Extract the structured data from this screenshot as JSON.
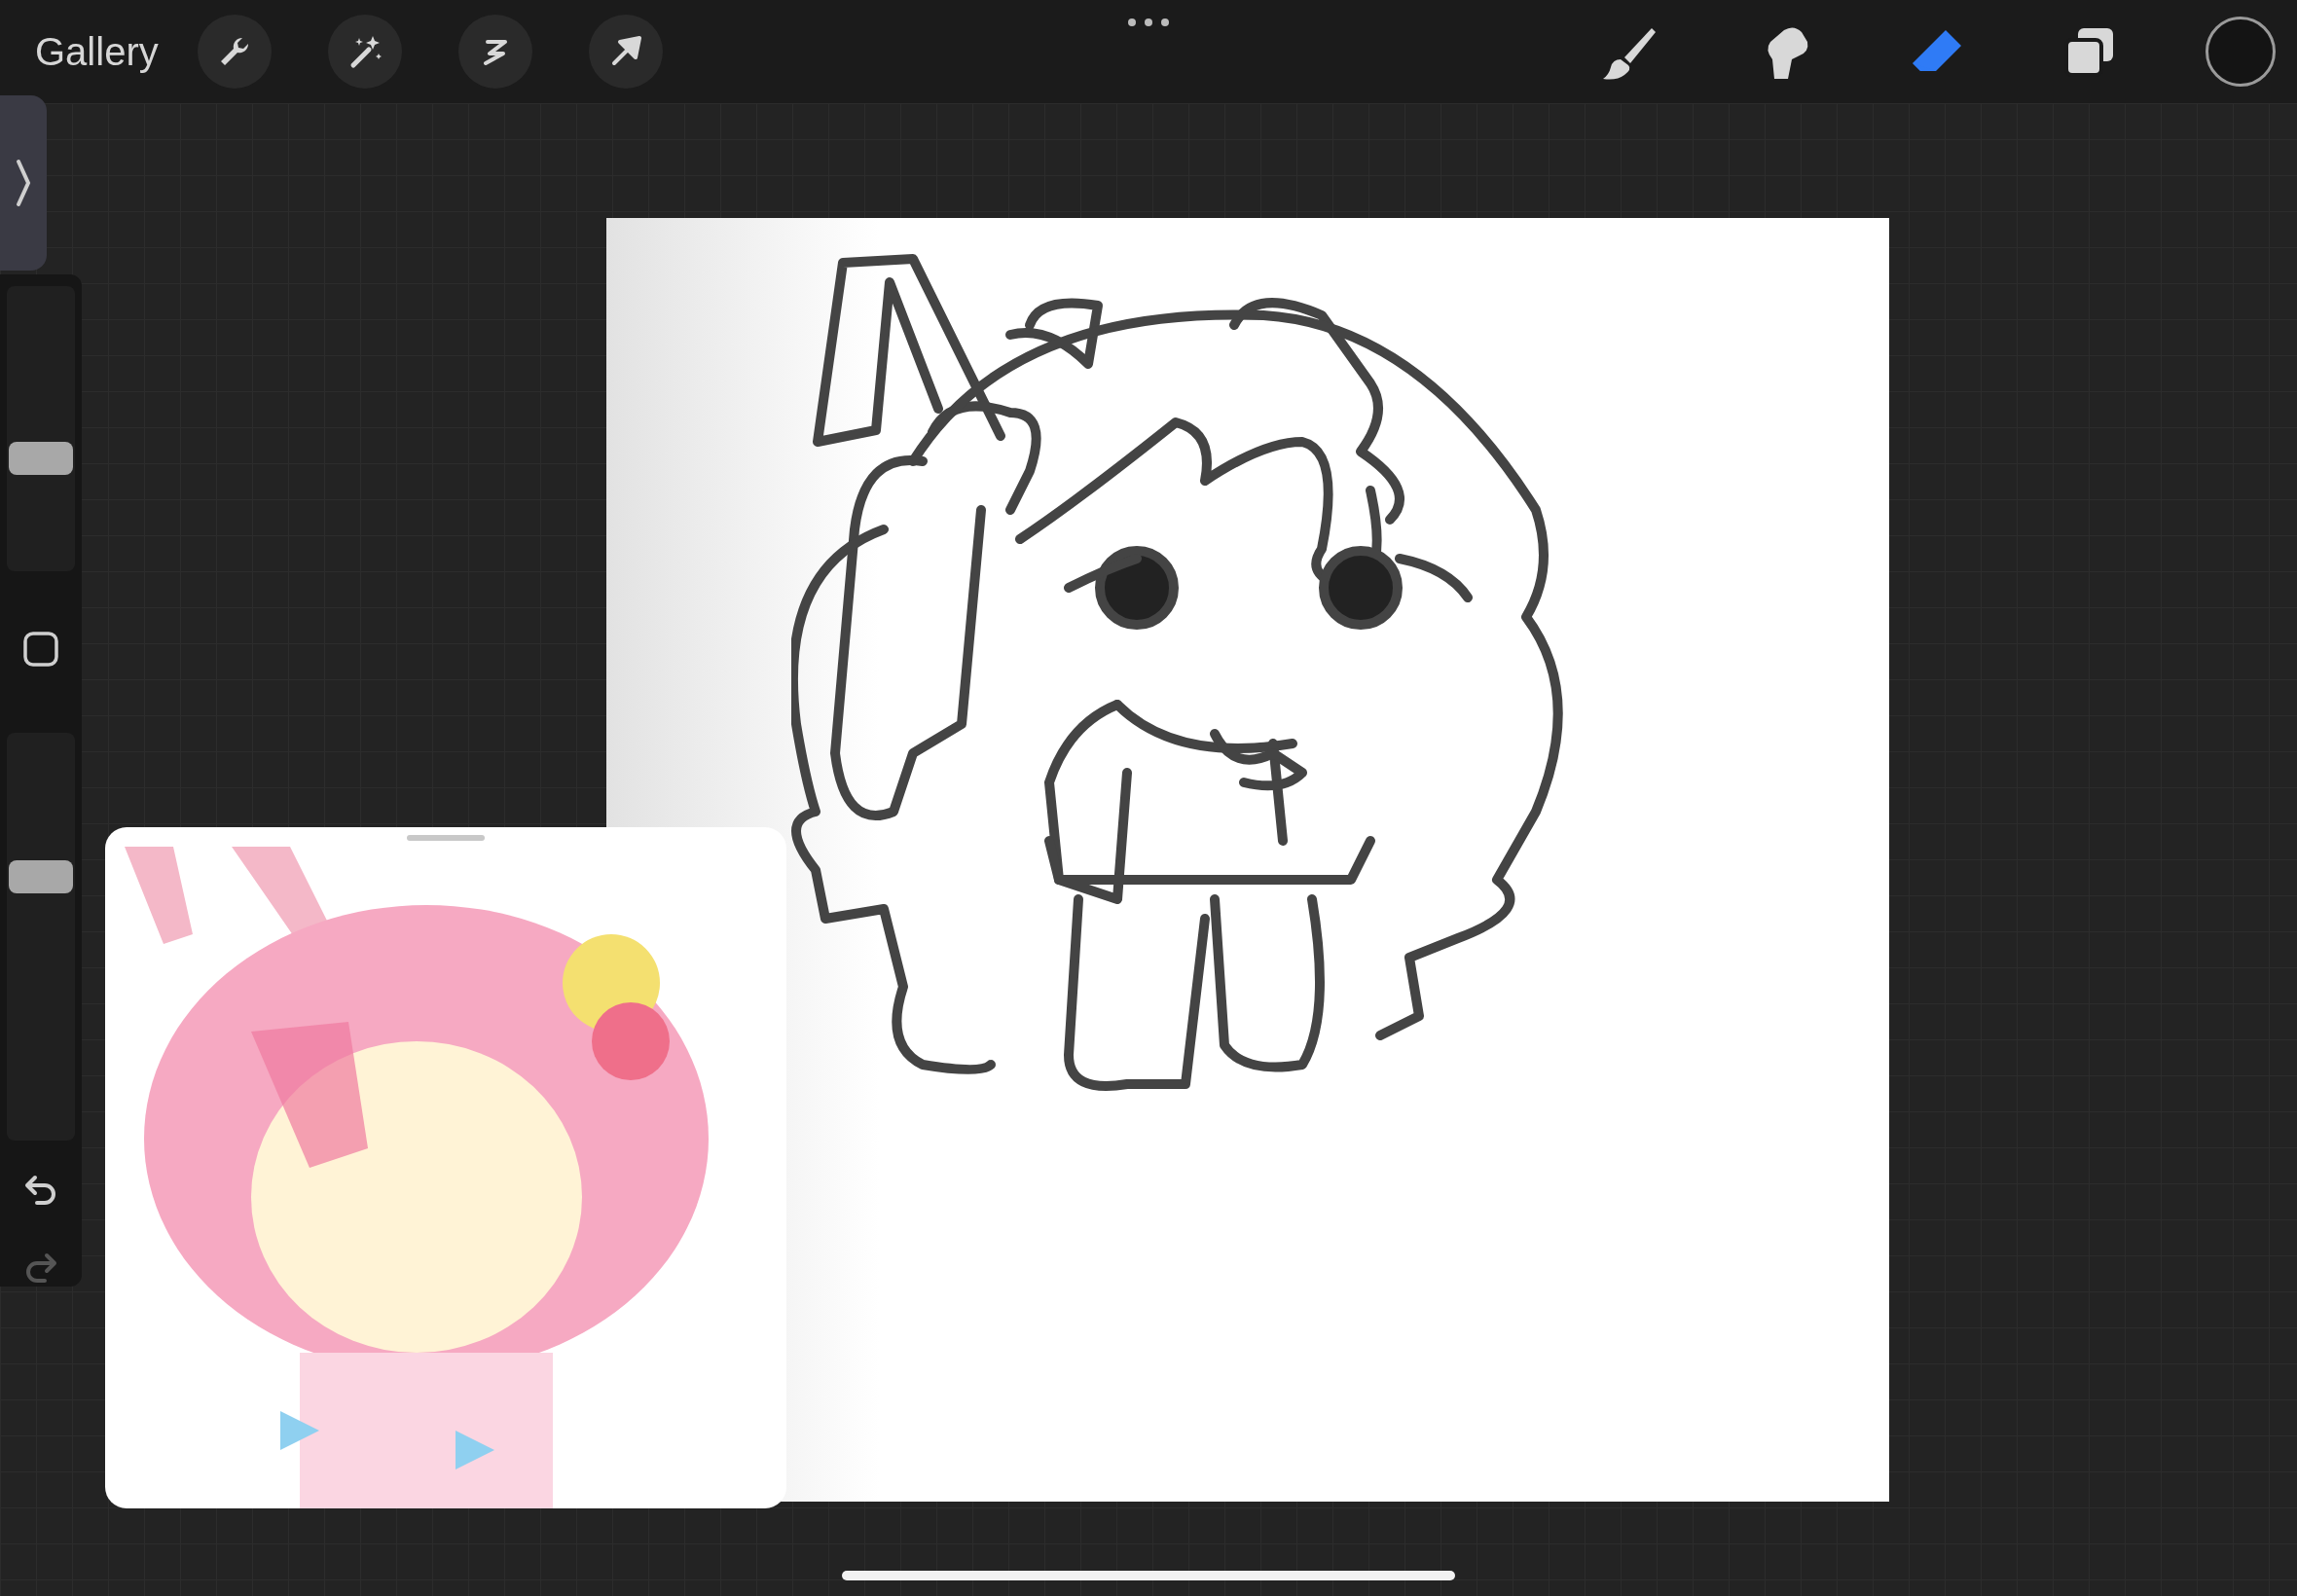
{
  "top_bar": {
    "gallery": "Gallery",
    "tools": [
      {
        "kind": "brush",
        "selected": false
      },
      {
        "kind": "smudge",
        "selected": false
      },
      {
        "kind": "eraser",
        "selected": true
      }
    ]
  },
  "sidebar": {
    "brush_size": {
      "level": 0.38
    },
    "opacity": {
      "level": 0.66
    },
    "undo": {
      "disabled": false
    },
    "redo": {
      "disabled": true
    }
  }
}
